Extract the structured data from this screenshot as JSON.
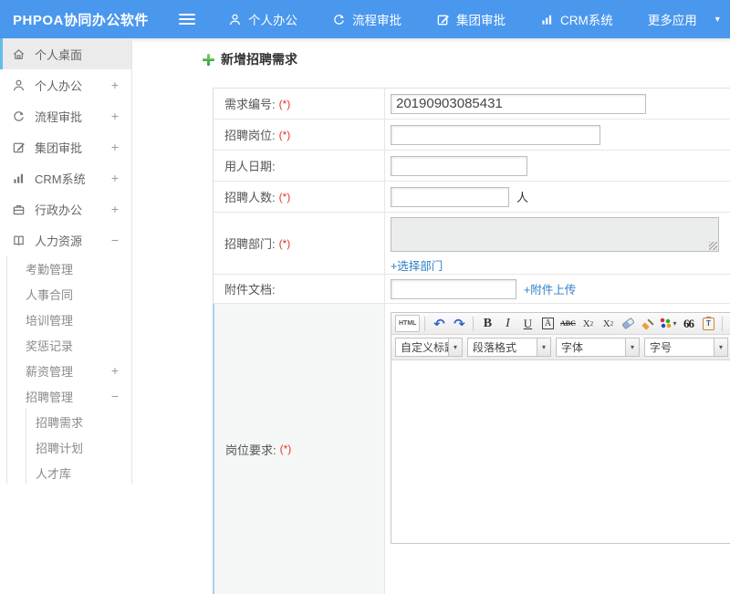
{
  "colors": {
    "header_blue": "#4a97ee",
    "link_blue": "#2f7ec7",
    "required_red": "#e2342c",
    "plus_green": "#3fae49",
    "active_border": "#63bce9"
  },
  "header": {
    "logo": "PHPOA协同办公软件",
    "caret": "▾",
    "nav": [
      {
        "label": "个人办公"
      },
      {
        "label": "流程审批"
      },
      {
        "label": "集团审批"
      },
      {
        "label": "CRM系统"
      },
      {
        "label": "更多应用"
      }
    ]
  },
  "sidebar": {
    "items": [
      {
        "label": "个人桌面"
      },
      {
        "label": "个人办公",
        "expand": "+"
      },
      {
        "label": "流程审批",
        "expand": "+"
      },
      {
        "label": "集团审批",
        "expand": "+"
      },
      {
        "label": "CRM系统",
        "expand": "+"
      },
      {
        "label": "行政办公",
        "expand": "+"
      },
      {
        "label": "人力资源",
        "expand": "−"
      }
    ],
    "hr_children": [
      "考勤管理",
      "人事合同",
      "培训管理",
      "奖惩记录"
    ],
    "salary_label": "薪资管理",
    "salary_expand": "+",
    "recruit_label": "招聘管理",
    "recruit_expand": "−",
    "recruit_children": [
      "招聘需求",
      "招聘计划",
      "人才库"
    ]
  },
  "main": {
    "title": "新增招聘需求",
    "form": {
      "rows": [
        {
          "label": "需求编号:",
          "required": "(*)",
          "value": "20190903085431"
        },
        {
          "label": "招聘岗位:",
          "required": "(*)"
        },
        {
          "label": "用人日期:"
        },
        {
          "label": "招聘人数:",
          "required": "(*)",
          "suffix": "人"
        },
        {
          "label": "招聘部门:",
          "required": "(*)",
          "link": "+选择部门"
        },
        {
          "label": "附件文档:",
          "link": "+附件上传"
        },
        {
          "label": "岗位要求:",
          "required": "(*)"
        }
      ]
    },
    "editor": {
      "html": "HTML",
      "undo": "↶",
      "redo": "↷",
      "bold": "B",
      "italic": "I",
      "underline": "U",
      "char_border": "A",
      "strike": "ABC",
      "sup_base": "X",
      "sup": "2",
      "sub_base": "X",
      "sub": "2",
      "quote": "66",
      "paste_t": "T",
      "font_color": "A",
      "bg_color": "a",
      "caret": "▾",
      "selects": [
        "自定义标题",
        "段落格式",
        "字体",
        "字号"
      ]
    }
  }
}
